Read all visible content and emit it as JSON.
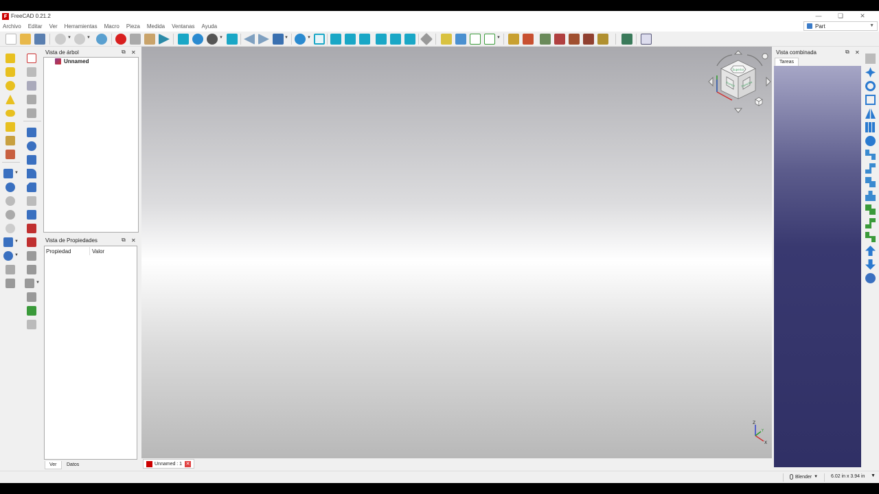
{
  "window": {
    "title": "FreeCAD 0.21.2",
    "logo_text": "F"
  },
  "menu": [
    "Archivo",
    "Editar",
    "Ver",
    "Herramientas",
    "Macro",
    "Pieza",
    "Medida",
    "Ventanas",
    "Ayuda"
  ],
  "workbench": {
    "selected": "Part"
  },
  "tree_panel": {
    "title": "Vista de árbol",
    "document": "Unnamed"
  },
  "property_panel": {
    "title": "Vista de Propiedades",
    "columns": [
      "Propiedad",
      "Valor"
    ],
    "tabs": [
      "Ver",
      "Datos"
    ]
  },
  "combo_panel": {
    "title": "Vista combinada",
    "tab": "Tareas"
  },
  "document_tab": {
    "label": "Unnamed : 1"
  },
  "navcube": {
    "faces": [
      "Superior",
      "Frontal",
      "Derecha"
    ]
  },
  "axis": {
    "labels": [
      "Z",
      "X",
      "Y"
    ]
  },
  "statusbar": {
    "nav_style": "Blender",
    "dimensions": "6.02 in x 3.94 in"
  },
  "colors": {
    "record": "#d81f1f",
    "accent_cyan": "#1aa7c6",
    "combo_bg": "#303065"
  }
}
